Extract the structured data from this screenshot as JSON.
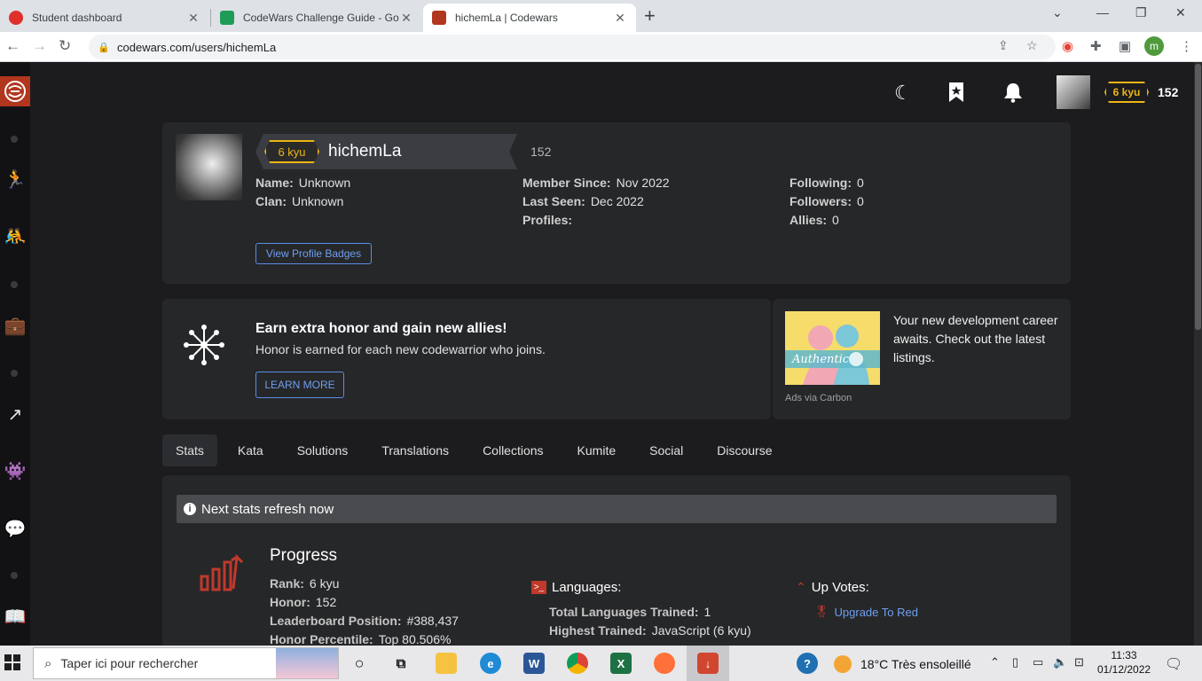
{
  "browser": {
    "tabs": [
      {
        "title": "Student dashboard",
        "color": "#e0302b"
      },
      {
        "title": "CodeWars Challenge Guide - Goo",
        "color": "#1e9c57"
      },
      {
        "title": "hichemLa | Codewars",
        "color": "#b1361e"
      }
    ],
    "url": "codewars.com/users/hichemLa",
    "profile_initial": "m"
  },
  "header": {
    "rank": "6 kyu",
    "honor": "152"
  },
  "profile": {
    "rank": "6 kyu",
    "username": "hichemLa",
    "honor": "152",
    "name_label": "Name:",
    "name_value": "Unknown",
    "clan_label": "Clan:",
    "clan_value": "Unknown",
    "member_label": "Member Since:",
    "member_value": "Nov 2022",
    "lastseen_label": "Last Seen:",
    "lastseen_value": "Dec 2022",
    "profiles_label": "Profiles:",
    "following_label": "Following:",
    "following_value": "0",
    "followers_label": "Followers:",
    "followers_value": "0",
    "allies_label": "Allies:",
    "allies_value": "0",
    "badges_button": "View Profile Badges"
  },
  "honor_card": {
    "title": "Earn extra honor and gain new allies!",
    "subtitle": "Honor is earned for each new codewarrior who joins.",
    "button": "LEARN MORE"
  },
  "ad": {
    "text": "Your new development career awaits. Check out the latest listings.",
    "image_text": "Authentic",
    "via": "Ads via Carbon"
  },
  "tabs": [
    "Stats",
    "Kata",
    "Solutions",
    "Translations",
    "Collections",
    "Kumite",
    "Social",
    "Discourse"
  ],
  "stats": {
    "refresh": "Next stats refresh now",
    "progress_title": "Progress",
    "rank_label": "Rank:",
    "rank_value": "6 kyu",
    "honor_label": "Honor:",
    "honor_value": "152",
    "leaderboard_label": "Leaderboard Position:",
    "leaderboard_value": "#388,437",
    "percentile_label": "Honor Percentile:",
    "percentile_value": "Top 80.506%",
    "languages_title": "Languages:",
    "total_lang_label": "Total Languages Trained:",
    "total_lang_value": "1",
    "highest_label": "Highest Trained:",
    "highest_value": "JavaScript (6 kyu)",
    "upvotes_title": "Up Votes:",
    "upgrade_link": "Upgrade To Red"
  },
  "taskbar": {
    "search_placeholder": "Taper ici pour rechercher",
    "weather": "18°C  Très ensoleillé",
    "time": "11:33",
    "date": "01/12/2022"
  }
}
